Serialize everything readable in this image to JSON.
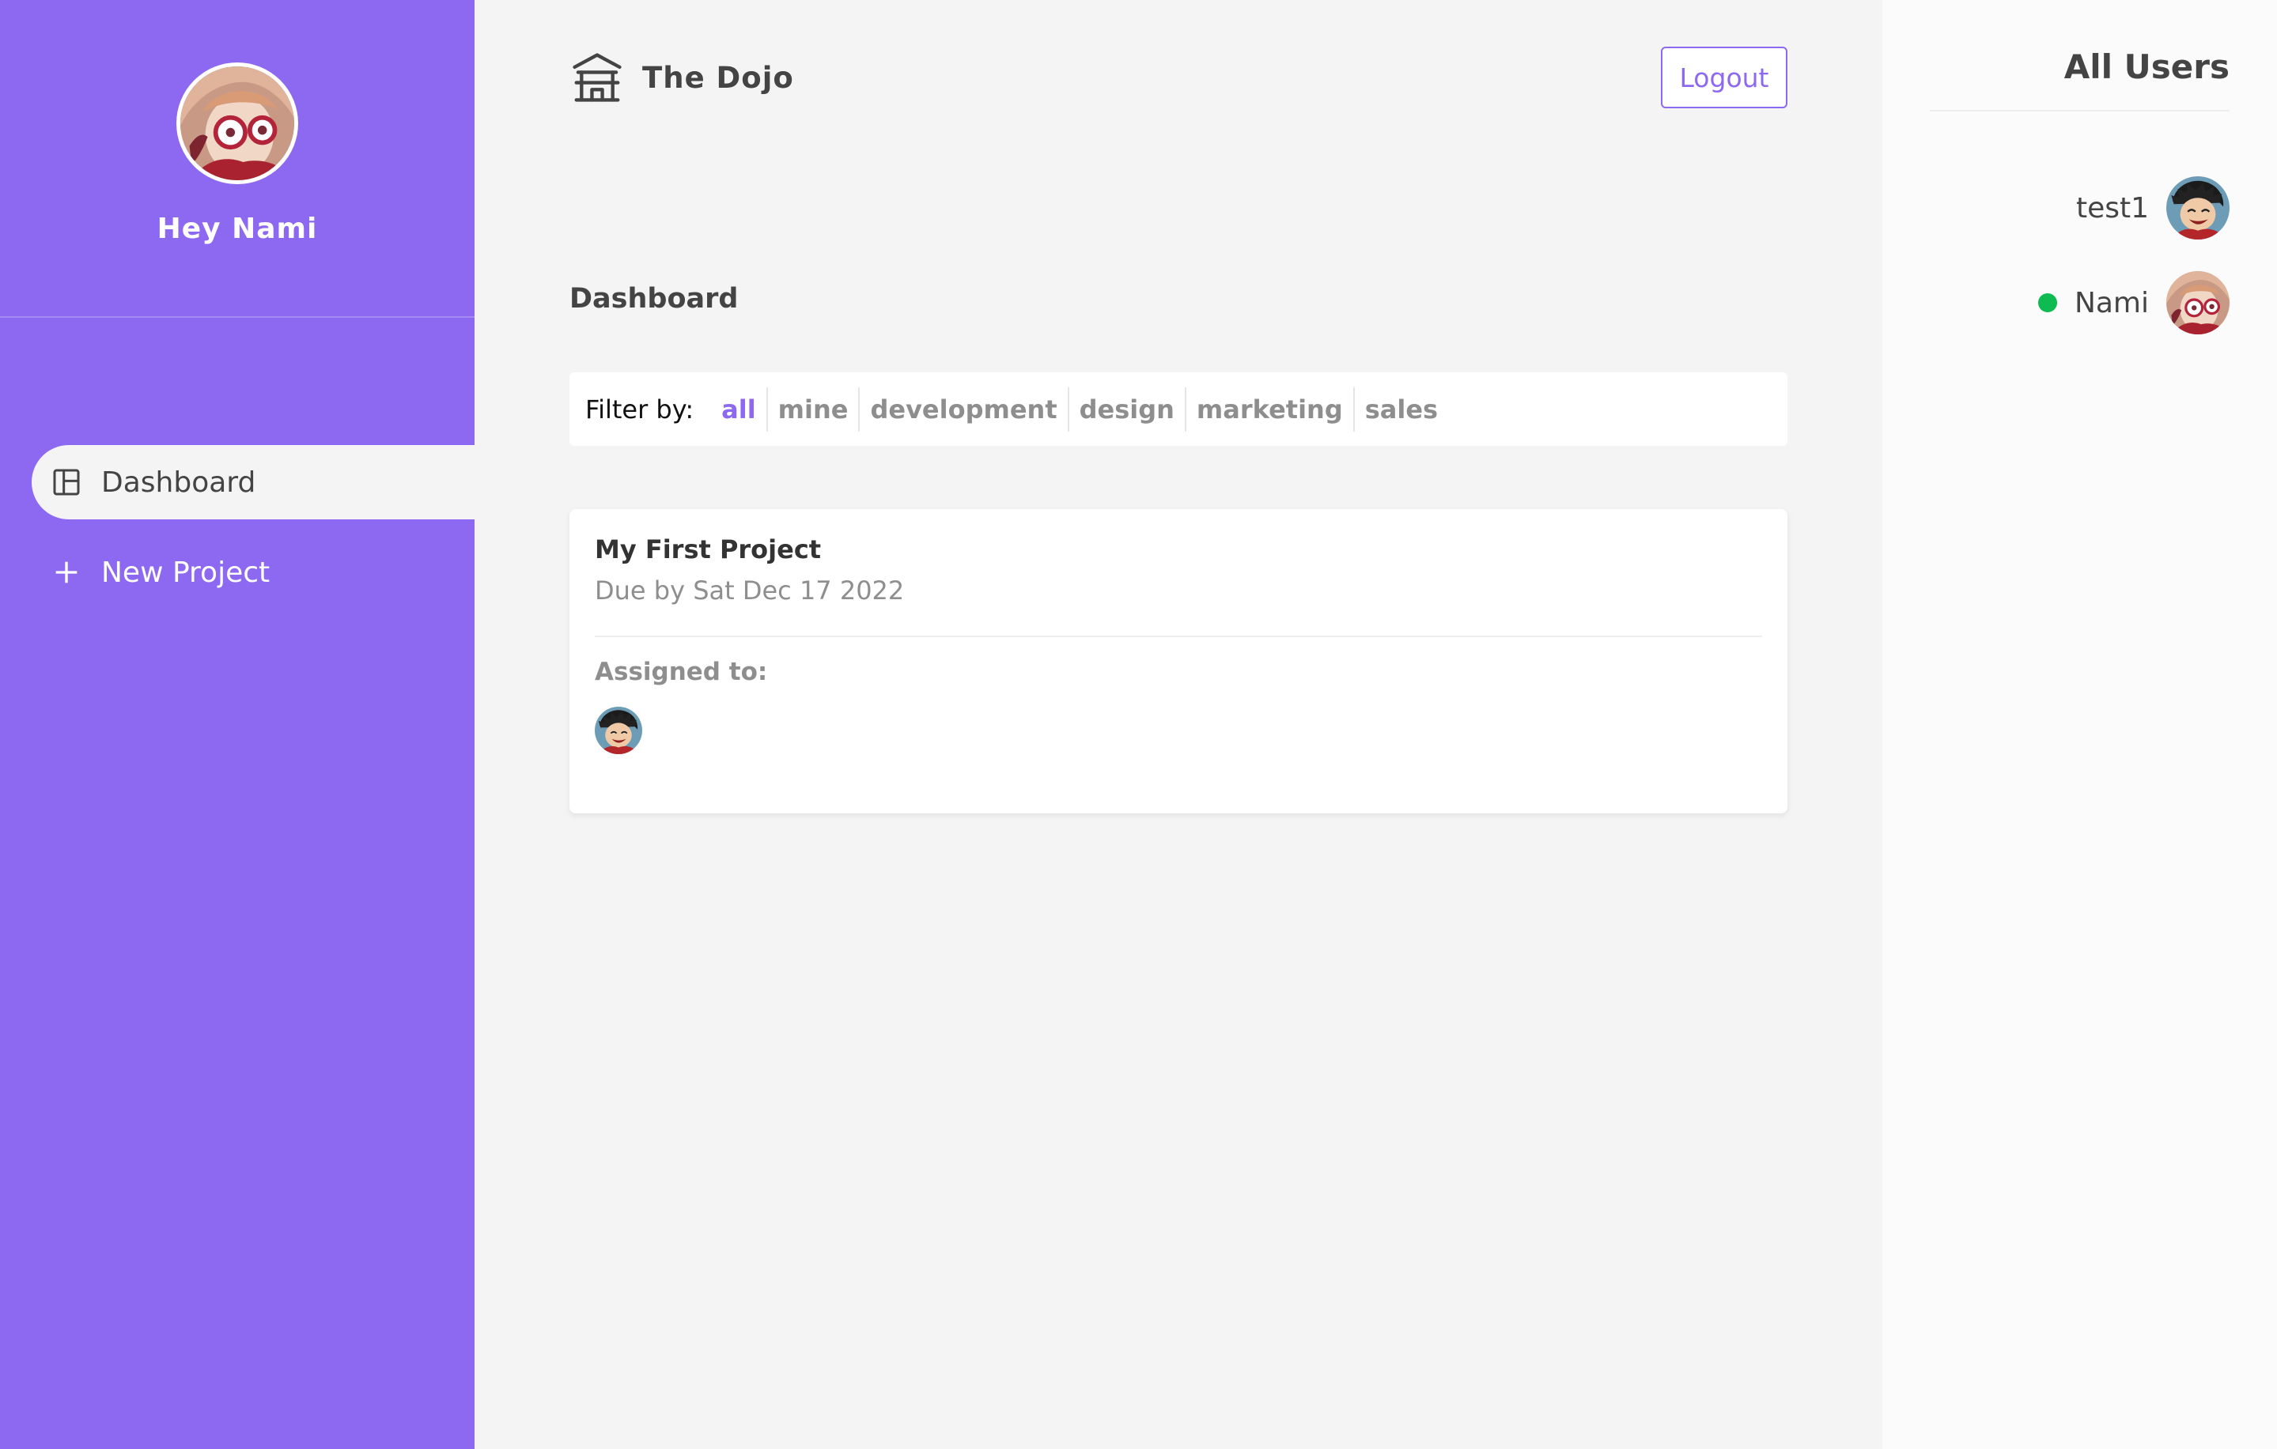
{
  "sidebar": {
    "greeting": "Hey Nami",
    "avatar_icon": "user-avatar-nami",
    "nav": [
      {
        "label": "Dashboard",
        "icon": "dashboard-icon",
        "active": true
      },
      {
        "label": "New Project",
        "icon": "plus-icon",
        "active": false
      }
    ]
  },
  "navbar": {
    "logo_icon": "temple-icon",
    "brand": "The Dojo",
    "logout_label": "Logout"
  },
  "main": {
    "title": "Dashboard",
    "filter": {
      "label": "Filter by:",
      "options": [
        "all",
        "mine",
        "development",
        "design",
        "marketing",
        "sales"
      ],
      "selected": "all"
    },
    "projects": [
      {
        "name": "My First Project",
        "due": "Due by Sat Dec 17 2022",
        "assigned_label": "Assigned to:",
        "assignees": [
          "test1"
        ]
      }
    ]
  },
  "users": {
    "title": "All Users",
    "list": [
      {
        "name": "test1",
        "online": false
      },
      {
        "name": "Nami",
        "online": true
      }
    ]
  },
  "colors": {
    "primary": "#8d69f1",
    "background": "#f4f4f4",
    "online": "#0ebb50",
    "text": "#444444",
    "muted": "#8e8e8e"
  }
}
